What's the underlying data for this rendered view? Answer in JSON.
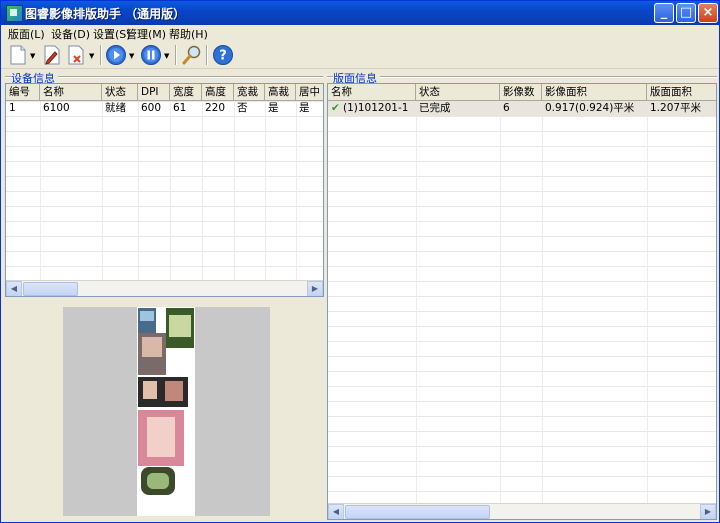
{
  "window": {
    "title": "图睿影像排版助手 （通用版）",
    "buttons": {
      "minimize": "_",
      "maximize": "□",
      "close": "×"
    }
  },
  "menu": [
    "版面(L)",
    "设备(D)",
    "设置(S)",
    "管理(M)",
    "帮助(H)"
  ],
  "toolbar_icons": [
    "new-document-icon",
    "edit-icon",
    "delete-icon",
    "play-icon",
    "pause-icon",
    "search-icon",
    "help-icon"
  ],
  "device_panel": {
    "title": "设备信息",
    "columns": [
      "编号",
      "名称",
      "状态",
      "DPI",
      "宽度",
      "高度",
      "宽裁",
      "高裁",
      "居中"
    ],
    "rows": [
      [
        "1",
        "6100",
        "就绪",
        "600",
        "61",
        "220",
        "否",
        "是",
        "是"
      ]
    ]
  },
  "layout_panel": {
    "title": "版面信息",
    "columns": [
      "名称",
      "状态",
      "影像数",
      "影像面积",
      "版面面积"
    ],
    "rows": [
      {
        "check": "✔",
        "name": "(1)101201-1",
        "status": "已完成",
        "count": "6",
        "image_area": "0.917(0.924)平米",
        "layout_area": "1.207平米"
      }
    ]
  },
  "colors": {
    "titlebar": "#0a4fd4",
    "panel_title": "#0033cc",
    "check": "#2e9a2e"
  }
}
